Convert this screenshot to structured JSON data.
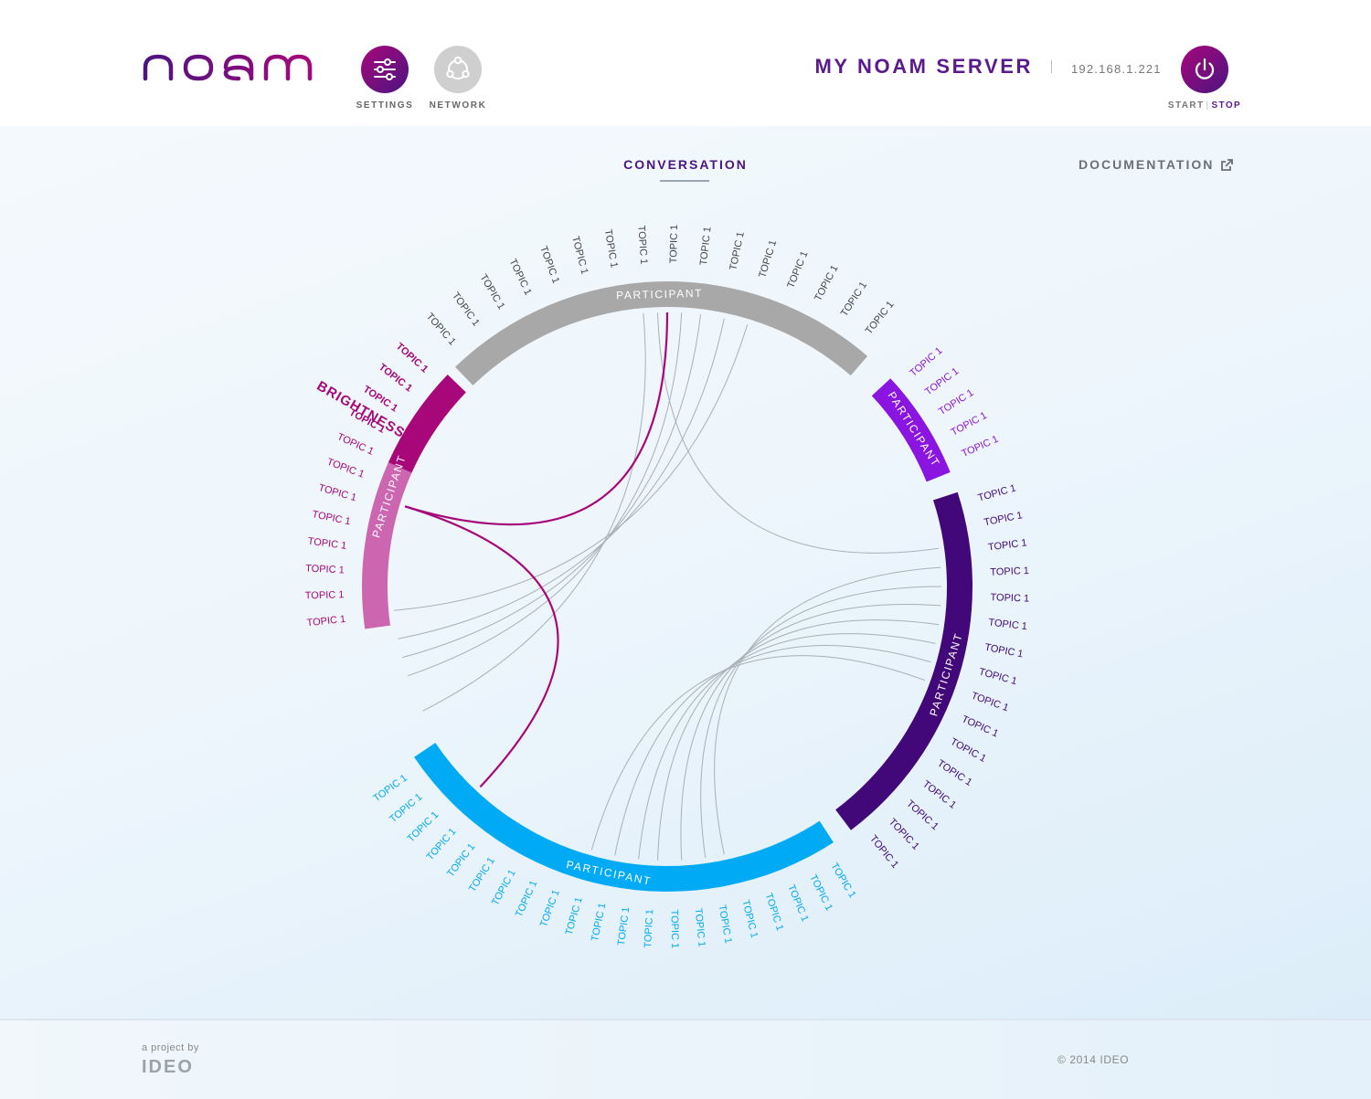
{
  "header": {
    "logo_text": "noam",
    "settings_label": "SETTINGS",
    "network_label": "NETWORK",
    "server_title": "MY NOAM SERVER",
    "ip": "192.168.1.221",
    "start_label": "START",
    "stop_label": "STOP"
  },
  "nav": {
    "conversation_label": "CONVERSATION",
    "documentation_label": "DOCUMENTATION"
  },
  "diagram": {
    "participants": [
      {
        "label": "PARTICIPANT",
        "color": "#a8a8a8",
        "topic_color": "#444444",
        "start": -44,
        "end": 41,
        "topics": 16
      },
      {
        "label": "PARTICIPANT",
        "color": "#8a14e0",
        "topic_color": "#8a14e0",
        "start": 47,
        "end": 68,
        "topics": 5
      },
      {
        "label": "PARTICIPANT",
        "color": "#42087a",
        "topic_color": "#42087a",
        "start": 72,
        "end": 143,
        "topics": 16
      },
      {
        "label": "PARTICIPANT",
        "color": "#00aaf4",
        "topic_color": "#00aaf4",
        "start": 147,
        "end": 236,
        "topics": 21
      },
      {
        "label": "PARTICIPANT",
        "color": "#a8077a",
        "light_color": "#cc66b0",
        "topic_color": "#a8077a",
        "start": 262,
        "end": 314,
        "topics": 12
      }
    ],
    "topic_label": "TOPIC 1",
    "highlight_label": "BRIGHTNESS"
  },
  "footer": {
    "project_by": "a project by",
    "company": "IDEO",
    "copyright": "© 2014 IDEO"
  },
  "colors": {
    "brand": "#5a1a8c",
    "settings_gradient": [
      "#a8077a",
      "#4b1582"
    ],
    "network": "#cfcfcf"
  },
  "icons": [
    "settings-icon",
    "network-icon",
    "power-icon",
    "external-link-icon"
  ]
}
